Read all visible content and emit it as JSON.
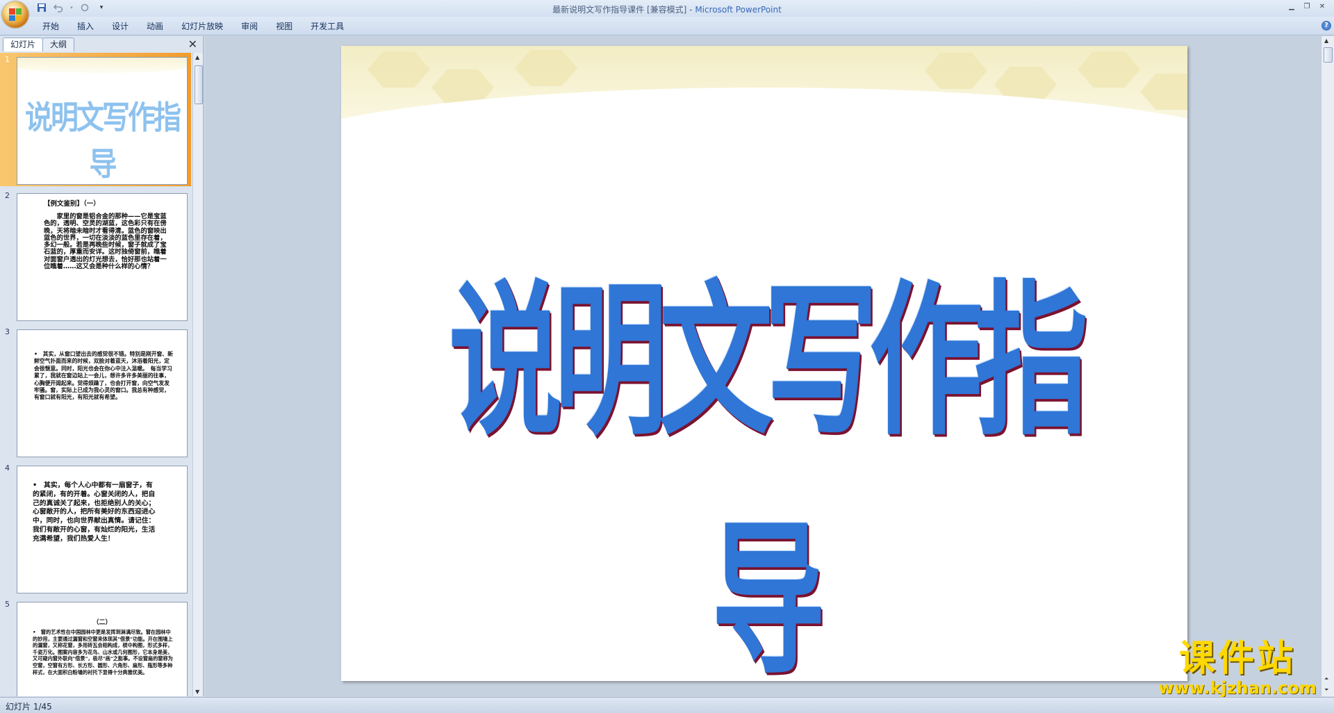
{
  "window": {
    "title": "最新说明文写作指导课件 [兼容模式] - ",
    "app_name": "Microsoft PowerPoint",
    "help_label": "?"
  },
  "ribbon": {
    "tabs": [
      "开始",
      "插入",
      "设计",
      "动画",
      "幻灯片放映",
      "审阅",
      "视图",
      "开发工具"
    ]
  },
  "pane": {
    "tabs": [
      "幻灯片",
      "大纲"
    ],
    "close": "✕"
  },
  "thumbnails": [
    {
      "num": "1",
      "title": "说明文写作指导"
    },
    {
      "num": "2",
      "heading": "【例文鉴别】（一）",
      "text": "　　家里的窗是铝合金的那种——它是宝蓝色的，透明、空灵的湖蓝，这色彩只有在傍晚，天将暗未暗时才看得清。蓝色的窗映出蓝色的世界，一切在淡淡的蓝色里存在着，多幻一般。若是再晚些时候，窗子就成了宝石蓝的，厚重而安详。这时独倚窗前，瞧着对面窗户透出的灯光想去，恰好那也站着一位瞧着……这又会是种什么样的心情？"
    },
    {
      "num": "3",
      "text": "•　其实，从窗口望出去的感觉很不错。特别是刚开窗、新鲜空气扑面而来的时候，双脸对着蓝天，沐浴着阳光，定会很惬意。同时，阳光也会在你心中注入温暖。　每当学习累了，我就在窗边站上一会儿，想许多许多美丽的往事，心胸便开阔起来。觉得烦躁了，也会打开窗，向空气发发牢骚。窗，实际上已成为我心灵的窗口。我总有种感觉，有窗口就有阳光，有阳光就有希望。"
    },
    {
      "num": "4",
      "text": "•　其实，每个人心中都有一扇窗子，有的紧闭，有的开着。心窗关闭的人，把自己的真诚关了起来，也拒绝别人的关心；心窗敞开的人，把所有美好的东西迎进心中，同时，也向世界献出真情。请记住：我们有敞开的心窗，有灿烂的阳光，生活充满希望，我们热爱人生！"
    },
    {
      "num": "5",
      "heading": "（二）",
      "text": "•　窗的艺术性在中国园林中更是发挥到淋漓尽致。窗在园林中的妙用，主要通过漏窗和空窗来体现其\"借景\"功能。开在围墙上的漏窗，又称花窗，多用砖瓦会相构成，棂中构图，形式多样，千姿万化。图案内容多为花鸟、山水或几何图形，它本身是美，又可窥内窗外联向\"借景\"，极尽\"画\"之能事。不设窗扇的窗称为空窗，空窗有方形、长方形、圆形、六角形、扇形、瓶形等多种样式，在大面积白粉墙的衬托下显得十分典雅优美。"
    }
  ],
  "slide": {
    "title": "说明文写作指导"
  },
  "status": {
    "slide_indicator": "幻灯片 1/45"
  },
  "watermark": {
    "brand": "课件站",
    "url": "www.kjzhan.com"
  }
}
